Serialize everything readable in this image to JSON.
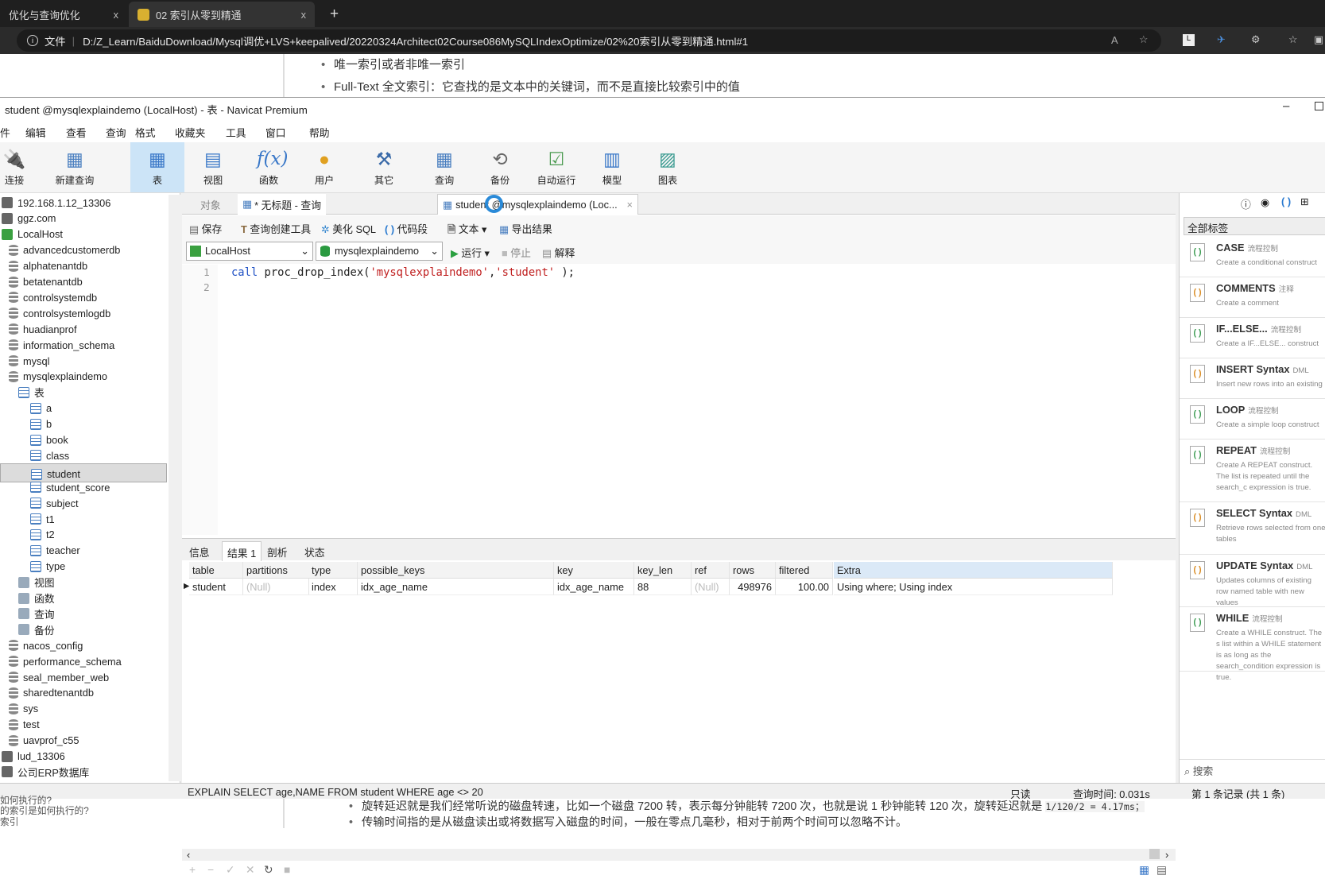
{
  "browser": {
    "tabs": [
      {
        "label": "优化与查询优化"
      },
      {
        "label": "02 索引从零到精通"
      }
    ],
    "close": "x",
    "new_tab": "+",
    "file_label": "文件",
    "url": "D:/Z_Learn/BaiduDownload/Mysql调优+LVS+keepalived/20220324Architect02Course086MySQLIndexOptimize/02%20索引从零到精通.html#1"
  },
  "web_top": {
    "bullets": [
      "唯一索引或者非唯一索引",
      "Full-Text 全文索引：它查找的是文本中的关键词，而不是直接比较索引中的值"
    ]
  },
  "navicat": {
    "title": "student @mysqlexplaindemo (LocalHost) - 表 - Navicat Premium",
    "menu": [
      "件",
      "编辑",
      "查看",
      "查询",
      "格式",
      "收藏夹",
      "工具",
      "窗口",
      "帮助"
    ],
    "toolbar": [
      "连接",
      "新建查询",
      "表",
      "视图",
      "函数",
      "用户",
      "其它",
      "查询",
      "备份",
      "自动运行",
      "模型",
      "图表"
    ],
    "sidebar": [
      {
        "label": "192.168.1.12_13306",
        "kind": "conn"
      },
      {
        "label": "ggz.com",
        "kind": "conn"
      },
      {
        "label": "LocalHost",
        "kind": "conn-on"
      },
      {
        "label": "advancedcustomerdb",
        "kind": "db"
      },
      {
        "label": "alphatenantdb",
        "kind": "db"
      },
      {
        "label": "betatenantdb",
        "kind": "db"
      },
      {
        "label": "controlsystemdb",
        "kind": "db"
      },
      {
        "label": "controlsystemlogdb",
        "kind": "db"
      },
      {
        "label": "huadianprof",
        "kind": "db"
      },
      {
        "label": "information_schema",
        "kind": "db"
      },
      {
        "label": "mysql",
        "kind": "db"
      },
      {
        "label": "mysqlexplaindemo",
        "kind": "db-on"
      },
      {
        "label": "表",
        "kind": "folder"
      },
      {
        "label": "a",
        "kind": "tbl"
      },
      {
        "label": "b",
        "kind": "tbl"
      },
      {
        "label": "book",
        "kind": "tbl"
      },
      {
        "label": "class",
        "kind": "tbl"
      },
      {
        "label": "student",
        "kind": "tbl",
        "selected": true
      },
      {
        "label": "student_score",
        "kind": "tbl"
      },
      {
        "label": "subject",
        "kind": "tbl"
      },
      {
        "label": "t1",
        "kind": "tbl"
      },
      {
        "label": "t2",
        "kind": "tbl"
      },
      {
        "label": "teacher",
        "kind": "tbl"
      },
      {
        "label": "type",
        "kind": "tbl"
      },
      {
        "label": "视图",
        "kind": "folder2"
      },
      {
        "label": "函数",
        "kind": "folder2"
      },
      {
        "label": "查询",
        "kind": "folder2"
      },
      {
        "label": "备份",
        "kind": "folder2"
      },
      {
        "label": "nacos_config",
        "kind": "db"
      },
      {
        "label": "performance_schema",
        "kind": "db"
      },
      {
        "label": "seal_member_web",
        "kind": "db"
      },
      {
        "label": "sharedtenantdb",
        "kind": "db"
      },
      {
        "label": "sys",
        "kind": "db"
      },
      {
        "label": "test",
        "kind": "db"
      },
      {
        "label": "uavprof_c55",
        "kind": "db"
      },
      {
        "label": "lud_13306",
        "kind": "conn"
      },
      {
        "label": "公司ERP数据库",
        "kind": "conn"
      }
    ],
    "obj_tabs": {
      "objects": "对象",
      "untitled": "* 无标题 - 查询",
      "current": "student @mysqlexplaindemo (Loc...",
      "close": "×"
    },
    "query_toolbar": {
      "save": "保存",
      "builder": "查询创建工具",
      "beautify": "美化 SQL",
      "snippet": "代码段",
      "text": "文本",
      "export": "导出结果"
    },
    "selectors": {
      "connection": "LocalHost",
      "database": "mysqlexplaindemo",
      "run": "运行",
      "stop": "停止",
      "explain": "解释"
    },
    "editor": {
      "lines": [
        "1",
        "2"
      ],
      "code": {
        "kw": "call",
        "fn": " proc_drop_index(",
        "s1": "'mysqlexplaindemo'",
        "comma": ",",
        "s2": "'student'",
        "end": " );"
      }
    },
    "result_tabs": [
      "信息",
      "结果 1",
      "剖析",
      "状态"
    ],
    "grid": {
      "columns": [
        "table",
        "partitions",
        "type",
        "possible_keys",
        "key",
        "key_len",
        "ref",
        "rows",
        "filtered",
        "Extra"
      ],
      "rows": [
        [
          "student",
          "(Null)",
          "index",
          "idx_age_name",
          "idx_age_name",
          "88",
          "(Null)",
          "498976",
          "100.00",
          "Using where; Using index"
        ]
      ]
    },
    "right_panel": {
      "filter": "全部标签",
      "search": "搜索",
      "snippets": [
        {
          "title": "CASE",
          "tag": "流程控制",
          "desc": "Create a conditional construct"
        },
        {
          "title": "COMMENTS",
          "tag": "注释",
          "desc": "Create a comment"
        },
        {
          "title": "IF...ELSE...",
          "tag": "流程控制",
          "desc": "Create a IF...ELSE... construct"
        },
        {
          "title": "INSERT Syntax",
          "tag": "DML",
          "desc": "Insert new rows into an existing"
        },
        {
          "title": "LOOP",
          "tag": "流程控制",
          "desc": "Create a simple loop construct"
        },
        {
          "title": "REPEAT",
          "tag": "流程控制",
          "desc": "Create A REPEAT construct. The list is repeated until the search_c expression is true."
        },
        {
          "title": "SELECT Syntax",
          "tag": "DML",
          "desc": "Retrieve rows selected from one tables"
        },
        {
          "title": "UPDATE Syntax",
          "tag": "DML",
          "desc": "Updates columns of existing row named table with new values"
        },
        {
          "title": "WHILE",
          "tag": "流程控制",
          "desc": "Create a WHILE construct. The s list within a WHILE statement is as long as the search_condition expression is true."
        }
      ]
    },
    "status": {
      "sql": "EXPLAIN SELECT age,NAME FROM student WHERE age <> 20",
      "mode": "只读",
      "time": "查询时间: 0.031s",
      "records": "第 1 条记录 (共 1 条)"
    }
  },
  "web_bottom": {
    "left": [
      "如何执行的?",
      "的索引是如何执行的?",
      "索引"
    ],
    "bullet": "旋转延迟就是我们经常听说的磁盘转速，比如一个磁盘 7200 转，表示每分钟能转 7200 次，也就是说 1 秒钟能转 120 次，旋转延迟就是",
    "formula": "1/120/2 = 4.17ms；",
    "bullet2": "传输时间指的是从磁盘读出或将数据写入磁盘的时间，一般在零点几毫秒，相对于前两个时间可以忽略不计。"
  }
}
